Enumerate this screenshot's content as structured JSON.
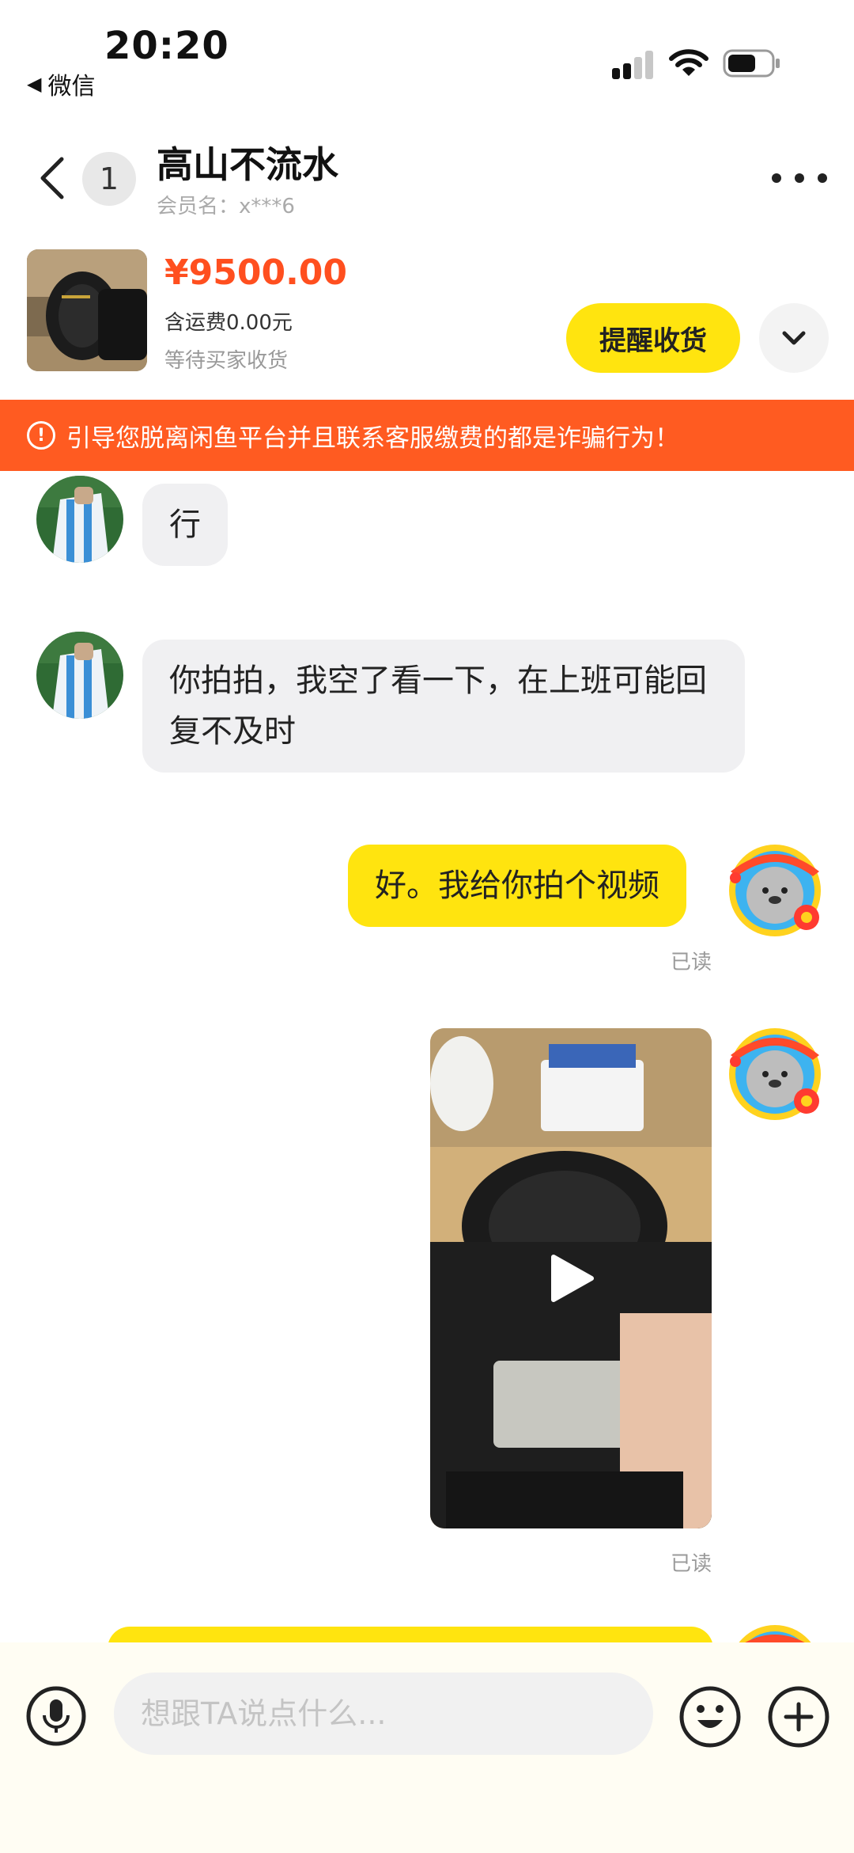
{
  "status_bar": {
    "time": "20:20",
    "back_app": "微信"
  },
  "header": {
    "unread_count": "1",
    "title": "高山不流水",
    "subtitle": "会员名：x***6"
  },
  "product": {
    "price": "¥9500.00",
    "shipping": "含运费0.00元",
    "status": "等待买家收货",
    "action_label": "提醒收货"
  },
  "warning": {
    "icon": "exclamation-circle-icon",
    "text": "引导您脱离闲鱼平台并且联系客服缴费的都是诈骗行为！"
  },
  "messages": [
    {
      "from": "peer",
      "type": "text",
      "text": "行"
    },
    {
      "from": "peer",
      "type": "text",
      "text": "你拍拍，我空了看一下，在上班可能回复不及时"
    },
    {
      "from": "me",
      "type": "text",
      "text": "好。我给你拍个视频",
      "receipt": "已读"
    },
    {
      "from": "me",
      "type": "video",
      "receipt": "已读"
    }
  ],
  "avatar_badge_text": "闲鱼小红花",
  "input": {
    "placeholder": "想跟TA说点什么..."
  },
  "colors": {
    "accent_yellow": "#ffe40f",
    "price_orange": "#ff4f1f",
    "warning_orange": "#ff5b21",
    "peer_bubble": "#f0f0f2"
  }
}
